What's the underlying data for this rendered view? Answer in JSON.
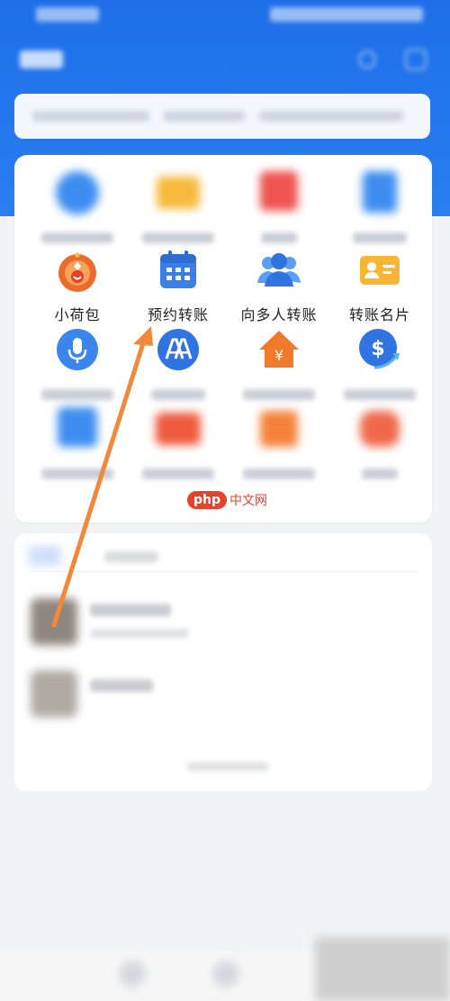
{
  "menu": {
    "items": [
      {
        "label": "小荷包",
        "icon": "wallet-icon"
      },
      {
        "label": "预约转账",
        "icon": "calendar-icon"
      },
      {
        "label": "向多人转账",
        "icon": "group-icon"
      },
      {
        "label": "转账名片",
        "icon": "card-icon"
      }
    ]
  },
  "watermark": {
    "brand": "php",
    "site": "中文网"
  },
  "colors": {
    "header_blue": "#1d6ee8",
    "annotation_arrow": "#f08a3a",
    "watermark_red": "#e6432f"
  }
}
